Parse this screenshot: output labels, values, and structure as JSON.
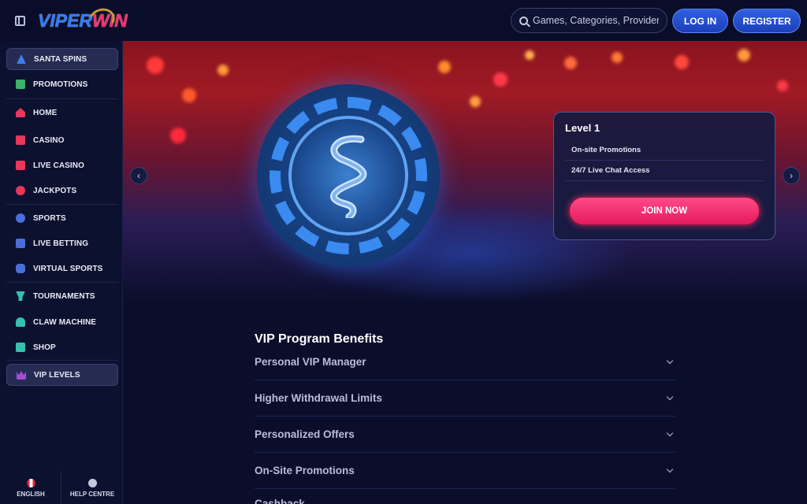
{
  "header": {
    "logo_part1": "VIPER",
    "logo_part2": "WIN",
    "search_placeholder": "Games, Categories, Providers",
    "login_label": "LOG IN",
    "register_label": "REGISTER"
  },
  "sidebar": {
    "items": [
      {
        "label": "SANTA SPINS",
        "icon": "tree-icon",
        "color": "#3f7cf0",
        "active": true
      },
      {
        "label": "PROMOTIONS",
        "icon": "gift-icon",
        "color": "#3db36a"
      },
      {
        "label": "HOME",
        "icon": "home-icon",
        "color": "#e8365c"
      },
      {
        "label": "CASINO",
        "icon": "slot-icon",
        "color": "#e8365c"
      },
      {
        "label": "LIVE CASINO",
        "icon": "cards-icon",
        "color": "#e8365c"
      },
      {
        "label": "JACKPOTS",
        "icon": "clover-icon",
        "color": "#e8365c"
      },
      {
        "label": "SPORTS",
        "icon": "ball-icon",
        "color": "#4b6fd8"
      },
      {
        "label": "LIVE BETTING",
        "icon": "tv-icon",
        "color": "#4b6fd8"
      },
      {
        "label": "VIRTUAL SPORTS",
        "icon": "gamepad-icon",
        "color": "#4b6fd8"
      },
      {
        "label": "TOURNAMENTS",
        "icon": "trophy-icon",
        "color": "#35c0b0"
      },
      {
        "label": "CLAW MACHINE",
        "icon": "claw-icon",
        "color": "#35c0b0"
      },
      {
        "label": "SHOP",
        "icon": "bag-icon",
        "color": "#35c0b0"
      },
      {
        "label": "VIP LEVELS",
        "icon": "crown-icon",
        "color": "#a64bd8",
        "active": true
      }
    ],
    "footer": {
      "language_label": "ENGLISH",
      "help_label": "HELP CENTRE"
    }
  },
  "banner": {
    "level_title": "Level 1",
    "level_perks": [
      "On-site Promotions",
      "24/7 Live Chat Access"
    ],
    "join_label": "JOIN NOW",
    "prev_arrow": "‹",
    "next_arrow": "›"
  },
  "benefits": {
    "title": "VIP Program Benefits",
    "items": [
      "Personal VIP Manager",
      "Higher Withdrawal Limits",
      "Personalized Offers",
      "On-Site Promotions",
      "Cashback"
    ]
  },
  "colors": {
    "background": "#0b0e2b",
    "accent_blue": "#2f5fe0",
    "accent_pink": "#ff3a78"
  }
}
